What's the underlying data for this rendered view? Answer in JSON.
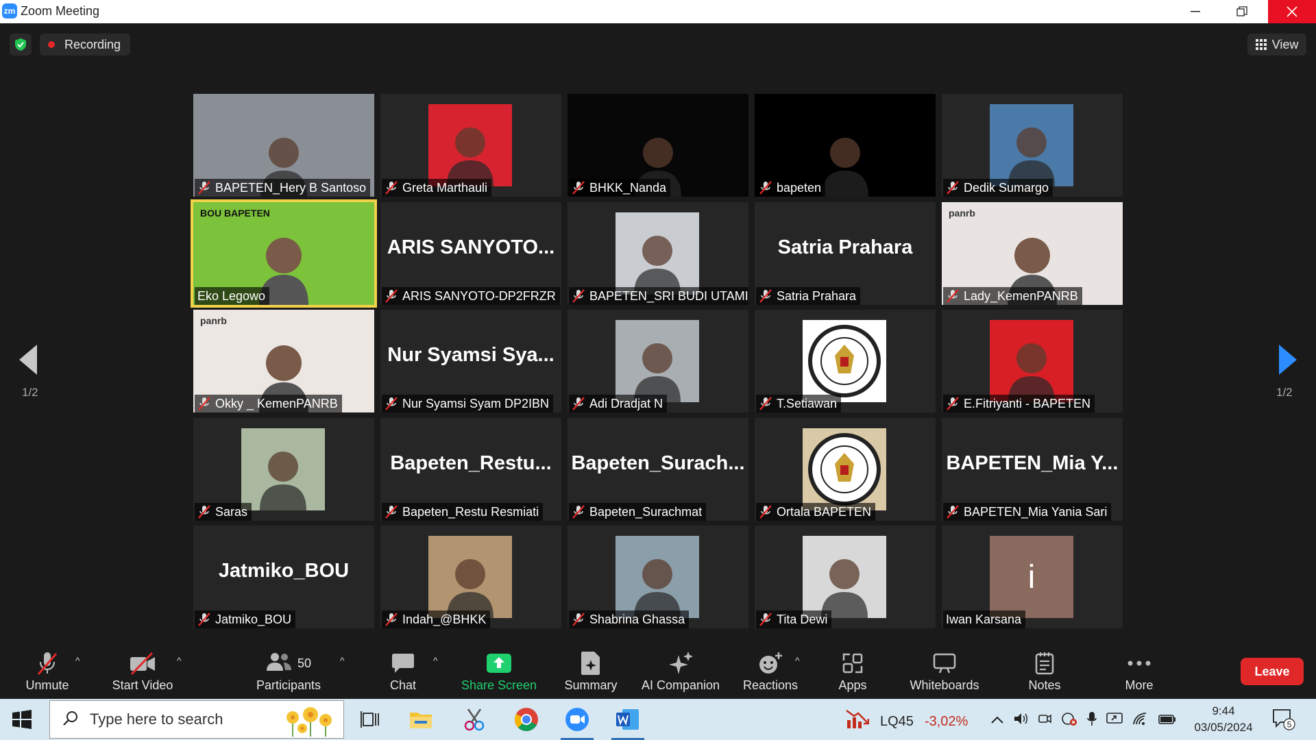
{
  "window": {
    "title": "Zoom Meeting",
    "app_badge": "zm"
  },
  "topbar": {
    "recording_label": "Recording",
    "view_label": "View"
  },
  "pager": {
    "left": "1/2",
    "right": "1/2"
  },
  "participants": [
    {
      "name": "BAPETEN_Hery B Santoso",
      "muted": true,
      "type": "full",
      "bg": "#8a8f96"
    },
    {
      "name": "Greta Marthauli",
      "muted": true,
      "type": "photo",
      "bg": "#d6232f"
    },
    {
      "name": "BHKK_Nanda",
      "muted": true,
      "type": "full",
      "bg": "#070707"
    },
    {
      "name": "bapeten",
      "muted": true,
      "type": "full",
      "bg": "#000000"
    },
    {
      "name": "Dedik Sumargo",
      "muted": true,
      "type": "photo",
      "bg": "#4b7aa8"
    },
    {
      "name": "Eko Legowo",
      "muted": false,
      "type": "full",
      "bg": "#7cc23a",
      "active": true,
      "banner": "BOU BAPETEN"
    },
    {
      "name": "ARIS SANYOTO-DP2FRZR",
      "muted": true,
      "type": "text",
      "big": "ARIS SANYOTO..."
    },
    {
      "name": "BAPETEN_SRI BUDI UTAMI",
      "muted": true,
      "type": "photo",
      "bg": "#c9ccd1"
    },
    {
      "name": "Satria Prahara",
      "muted": true,
      "type": "text",
      "big": "Satria Prahara"
    },
    {
      "name": "Lady_KemenPANRB",
      "muted": true,
      "type": "full",
      "bg": "#e9e4e2",
      "banner": "panrb"
    },
    {
      "name": "Okky _ KemenPANRB",
      "muted": true,
      "type": "full",
      "bg": "#ece7e3",
      "banner": "panrb"
    },
    {
      "name": "Nur Syamsi Syam DP2IBN",
      "muted": true,
      "type": "text",
      "big": "Nur Syamsi Sya..."
    },
    {
      "name": "Adi Dradjat N",
      "muted": true,
      "type": "photo",
      "bg": "#a9aeb3"
    },
    {
      "name": "T.Setiawan",
      "muted": true,
      "type": "photo",
      "bg": "#ffffff",
      "emblem": true
    },
    {
      "name": "E.Fitriyanti - BAPETEN",
      "muted": true,
      "type": "photo",
      "bg": "#d81f26"
    },
    {
      "name": "Saras",
      "muted": true,
      "type": "photo",
      "bg": "#a9b89f"
    },
    {
      "name": "Bapeten_Restu Resmiati",
      "muted": true,
      "type": "text",
      "big": "Bapeten_Restu..."
    },
    {
      "name": "Bapeten_Surachmat",
      "muted": true,
      "type": "text",
      "big": "Bapeten_Surach..."
    },
    {
      "name": "Ortala BAPETEN",
      "muted": true,
      "type": "photo",
      "bg": "#d9c9a6",
      "emblem": true
    },
    {
      "name": "BAPETEN_Mia Yania Sari",
      "muted": true,
      "type": "text",
      "big": "BAPETEN_Mia Y..."
    },
    {
      "name": "Jatmiko_BOU",
      "muted": true,
      "type": "text",
      "big": "Jatmiko_BOU"
    },
    {
      "name": "Indah_@BHKK",
      "muted": true,
      "type": "photo",
      "bg": "#b39470"
    },
    {
      "name": "Shabrina Ghassa",
      "muted": true,
      "type": "photo",
      "bg": "#8b9faa"
    },
    {
      "name": "Tita Dewi",
      "muted": true,
      "type": "photo",
      "bg": "#d8d8d8"
    },
    {
      "name": "Iwan Karsana",
      "muted": false,
      "type": "photo",
      "bg": "#8a6a5e",
      "initial": "i"
    }
  ],
  "toolbar": {
    "unmute": "Unmute",
    "start_video": "Start Video",
    "participants": "Participants",
    "participants_count": "50",
    "chat": "Chat",
    "share_screen": "Share Screen",
    "summary": "Summary",
    "ai_companion": "AI Companion",
    "reactions": "Reactions",
    "apps": "Apps",
    "whiteboards": "Whiteboards",
    "notes": "Notes",
    "more": "More",
    "leave": "Leave"
  },
  "taskbar": {
    "search_placeholder": "Type here to search",
    "stock_name": "LQ45",
    "stock_change": "-3,02%",
    "time": "9:44",
    "date": "03/05/2024",
    "notification_count": "5"
  },
  "colors": {
    "accent": "#2d8cff",
    "leave": "#e02828",
    "share": "#1fd06e",
    "active_speaker": "#f2d24a"
  }
}
